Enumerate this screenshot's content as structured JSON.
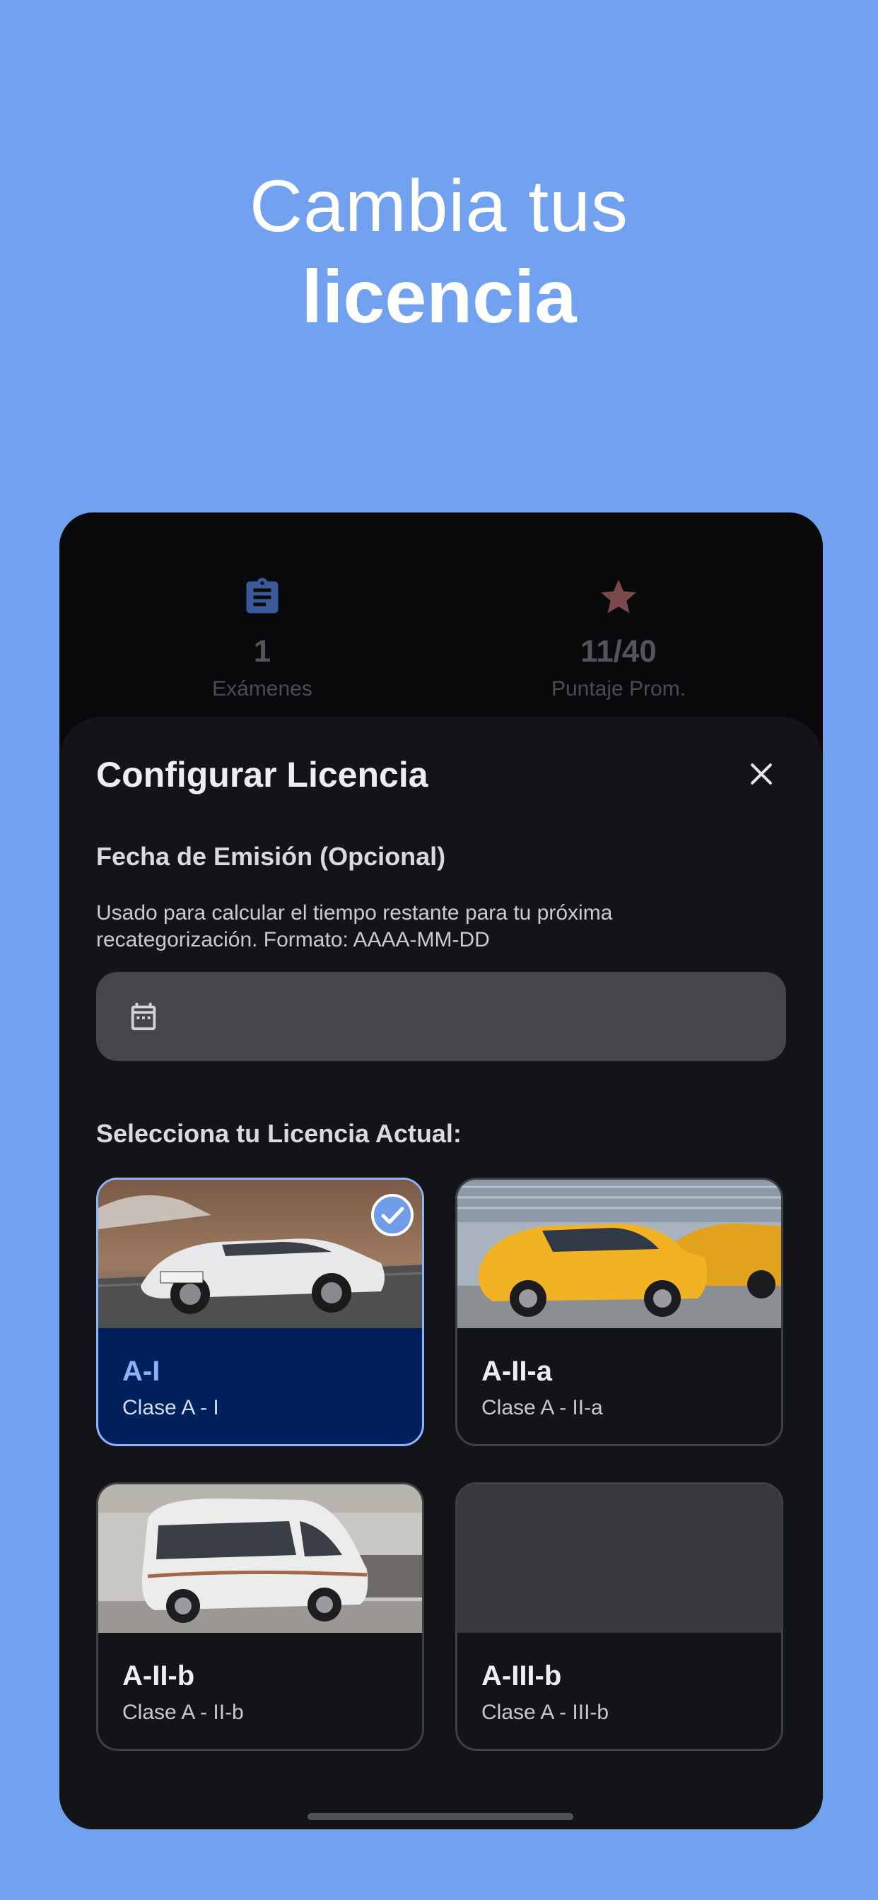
{
  "hero": {
    "line1": "Cambia tus",
    "line2": "licencia"
  },
  "stats": {
    "exams": {
      "value": "1",
      "label": "Exámenes",
      "icon": "clipboard-icon",
      "icon_color": "#3a5a99"
    },
    "score": {
      "value": "11/40",
      "label": "Puntaje Prom.",
      "icon": "star-icon",
      "icon_color": "#7a4a4a"
    }
  },
  "sheet": {
    "title": "Configurar Licencia",
    "date_section_title": "Fecha de Emisión (Opcional)",
    "date_helper": "Usado para calcular el tiempo restante para tu próxima recategorización. Formato: AAAA-MM-DD",
    "date_value": "",
    "license_section_title": "Selecciona tu Licencia Actual:"
  },
  "licenses": [
    {
      "code": "A-I",
      "subtitle": "Clase A - I",
      "selected": true
    },
    {
      "code": "A-II-a",
      "subtitle": "Clase A - II-a",
      "selected": false
    },
    {
      "code": "A-II-b",
      "subtitle": "Clase A - II-b",
      "selected": false
    },
    {
      "code": "A-III-b",
      "subtitle": "Clase A - III-b",
      "selected": false
    }
  ],
  "colors": {
    "background": "#72a2ef",
    "accent": "#8db4f8",
    "selected_card": "#00205c",
    "sheet": "#121418"
  }
}
